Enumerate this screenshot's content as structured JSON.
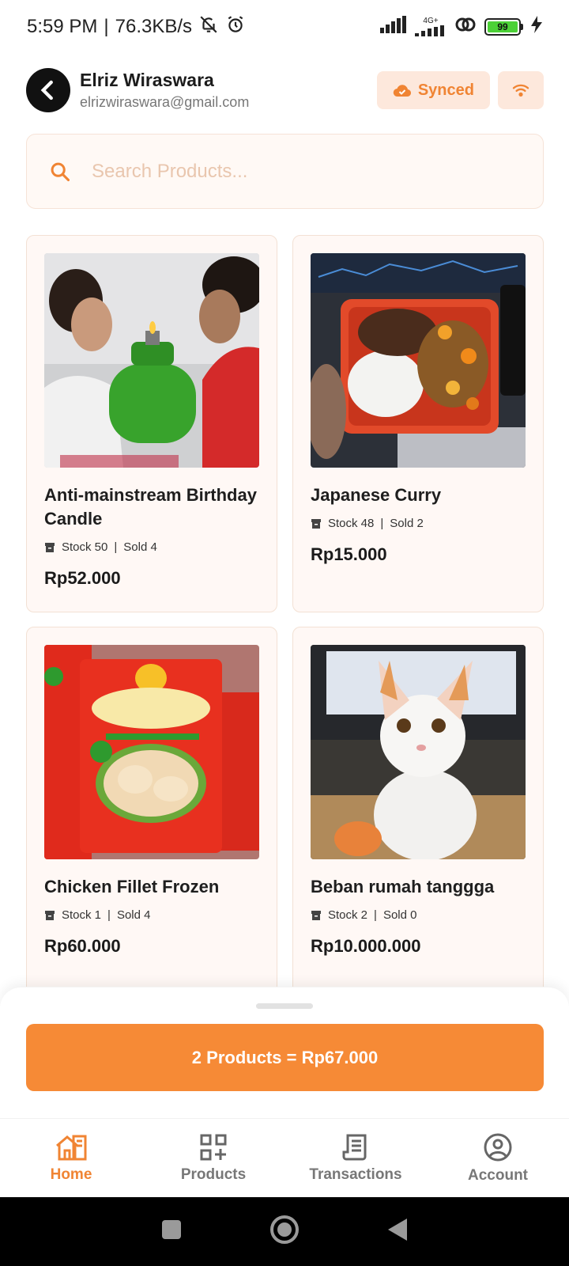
{
  "status_bar": {
    "time": "5:59 PM",
    "separator": "|",
    "speed": "76.3KB/s",
    "network": "4G+",
    "battery": "99"
  },
  "header": {
    "name": "Elriz Wiraswara",
    "email": "elrizwiraswara@gmail.com",
    "sync_label": "Synced"
  },
  "search": {
    "placeholder": "Search Products..."
  },
  "products": [
    {
      "name": "Anti-mainstream Birthday Candle",
      "stock": "Stock 50",
      "sold": "Sold 4",
      "price": "Rp52.000"
    },
    {
      "name": "Japanese Curry",
      "stock": "Stock 48",
      "sold": "Sold 2",
      "price": "Rp15.000"
    },
    {
      "name": "Chicken Fillet Frozen",
      "stock": "Stock 1",
      "sold": "Sold 4",
      "price": "Rp60.000"
    },
    {
      "name": "Beban rumah tanggga",
      "stock": "Stock 2",
      "sold": "Sold 0",
      "price": "Rp10.000.000"
    }
  ],
  "meta_separator": "|",
  "checkout": {
    "label": "2 Products = Rp67.000"
  },
  "nav": {
    "home": "Home",
    "products": "Products",
    "transactions": "Transactions",
    "account": "Account"
  },
  "colors": {
    "accent": "#f68a36",
    "accent_light": "#fde8dc",
    "card_bg": "#fff8f5"
  }
}
